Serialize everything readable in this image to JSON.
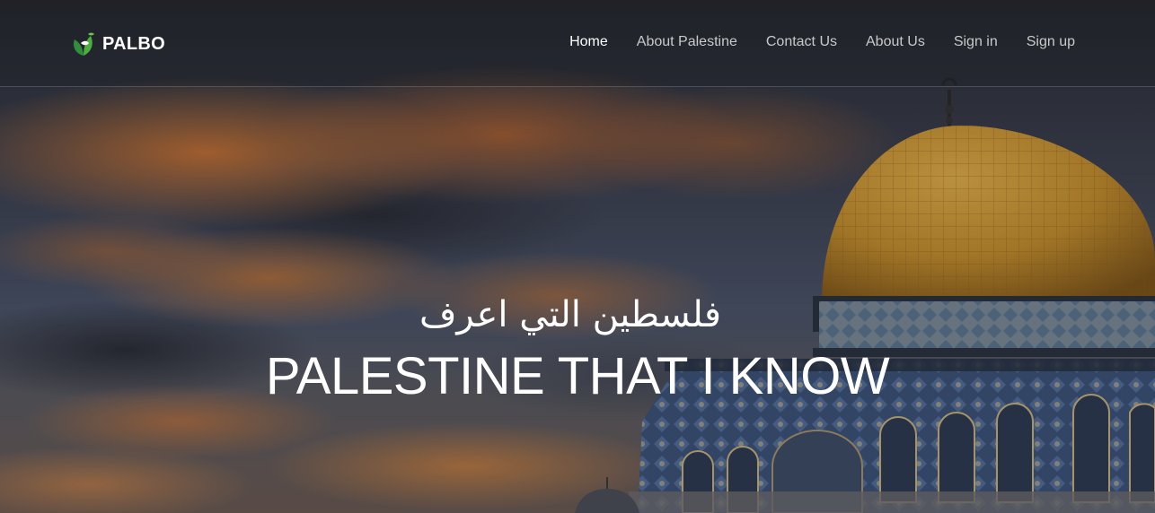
{
  "brand": {
    "name": "PALBO",
    "logo_icon": "olive-leaf-logo-icon"
  },
  "nav": {
    "items": [
      {
        "label": "Home",
        "active": true
      },
      {
        "label": "About Palestine",
        "active": false
      },
      {
        "label": "Contact Us",
        "active": false
      },
      {
        "label": "About Us",
        "active": false
      },
      {
        "label": "Sign in",
        "active": false
      },
      {
        "label": "Sign up",
        "active": false
      }
    ]
  },
  "hero": {
    "title_arabic": "فلسطين التي اعرف",
    "title_english": "PALESTINE THAT I KNOW",
    "background": "dome-of-the-rock-sunset-image"
  },
  "colors": {
    "nav_active": "#ffffff",
    "nav_inactive": "#c9c9c9",
    "dome_gold": "#c7922c",
    "tile_blue": "#3e5a86"
  }
}
